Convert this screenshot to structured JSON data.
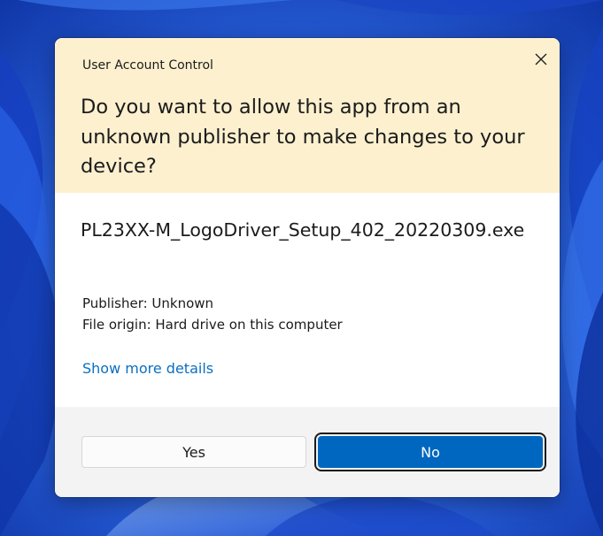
{
  "dialog": {
    "title": "User Account Control",
    "question": "Do you want to allow this app from an unknown publisher to make changes to your device?",
    "app_name": "PL23XX-M_LogoDriver_Setup_402_20220309.exe",
    "publisher_line": "Publisher: Unknown",
    "origin_line": "File origin: Hard drive on this computer",
    "details_link": "Show more details",
    "yes_label": "Yes",
    "no_label": "No"
  },
  "colors": {
    "header_bg": "#fcf0cf",
    "accent": "#0067c0",
    "link": "#0a6fc2",
    "footer_bg": "#f3f3f3"
  },
  "icons": {
    "close": "close-icon"
  }
}
